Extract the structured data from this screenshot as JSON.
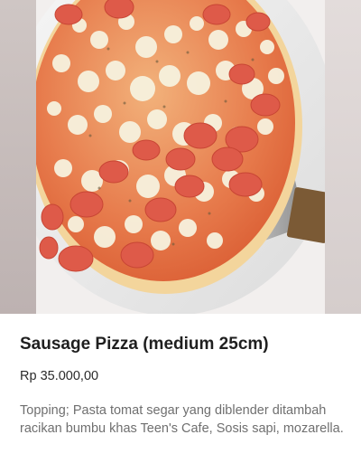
{
  "product": {
    "title": "Sausage Pizza (medium 25cm)",
    "price": "Rp 35.000,00",
    "description": "Topping; Pasta tomat segar yang diblender ditambah racikan bumbu khas Teen's Cafe, Sosis sapi, mozarella."
  },
  "colors": {
    "title": "#1f1f1f",
    "price": "#2a2a2a",
    "description": "#6f6f6f"
  }
}
